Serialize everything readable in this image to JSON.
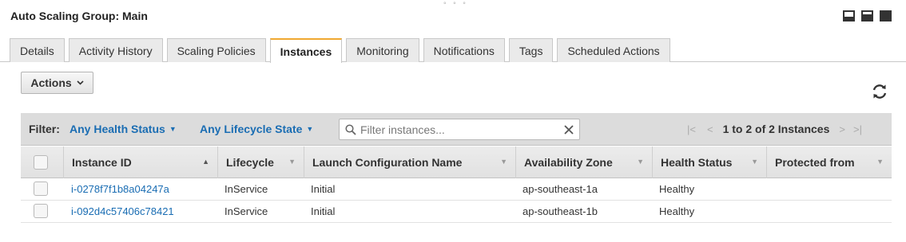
{
  "panel": {
    "drag_handle": "° ° °",
    "title": "Auto Scaling Group: Main"
  },
  "tabs": [
    {
      "label": "Details"
    },
    {
      "label": "Activity History"
    },
    {
      "label": "Scaling Policies"
    },
    {
      "label": "Instances",
      "active": true
    },
    {
      "label": "Monitoring"
    },
    {
      "label": "Notifications"
    },
    {
      "label": "Tags"
    },
    {
      "label": "Scheduled Actions"
    }
  ],
  "toolbar": {
    "actions_label": "Actions",
    "refresh_icon": "refresh-icon"
  },
  "filter": {
    "label": "Filter:",
    "health_status": "Any Health Status",
    "lifecycle_state": "Any Lifecycle State",
    "search_placeholder": "Filter instances...",
    "search_value": ""
  },
  "pager": {
    "text": "1 to 2 of 2 Instances"
  },
  "table": {
    "columns": [
      "Instance ID",
      "Lifecycle",
      "Launch Configuration Name",
      "Availability Zone",
      "Health Status",
      "Protected from"
    ],
    "rows": [
      {
        "instance_id": "i-0278f7f1b8a04247a",
        "lifecycle": "InService",
        "launch_config": "Initial",
        "availability_zone": "ap-southeast-1a",
        "health_status": "Healthy",
        "protected_from": ""
      },
      {
        "instance_id": "i-092d4c57406c78421",
        "lifecycle": "InService",
        "launch_config": "Initial",
        "availability_zone": "ap-southeast-1b",
        "health_status": "Healthy",
        "protected_from": ""
      }
    ]
  },
  "colors": {
    "link": "#1a6db3",
    "active_tab_accent": "#f0a830",
    "header_bg": "#dcdcdc"
  }
}
